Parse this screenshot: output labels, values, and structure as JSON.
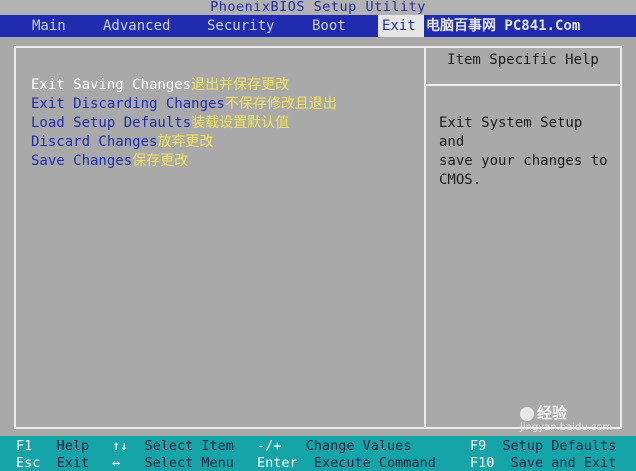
{
  "title": "PhoenixBIOS Setup Utility",
  "menu": [
    {
      "label": "Main"
    },
    {
      "label": "Advanced"
    },
    {
      "label": "Security"
    },
    {
      "label": "Boot"
    },
    {
      "label": "Exit",
      "active": true
    }
  ],
  "watermark": "电脑百事网 PC841.Com",
  "options": [
    {
      "en": "Exit Saving Changes",
      "cn": "退出并保存更改"
    },
    {
      "en": "Exit Discarding Changes",
      "cn": "不保存修改且退出"
    },
    {
      "en": "Load Setup Defaults",
      "cn": "装载设置默认值"
    },
    {
      "en": "Discard Changes",
      "cn": "放弃更改"
    },
    {
      "en": "Save Changes",
      "cn": "保存更改"
    }
  ],
  "help": {
    "title": "Item Specific Help",
    "text": "Exit System Setup and\nsave your changes to\nCMOS."
  },
  "footer": {
    "row1": [
      {
        "key": "F1",
        "desc": "Help"
      },
      {
        "key": "↑↓",
        "desc": "Select Item"
      },
      {
        "key": "-/+",
        "desc": "Change Values"
      },
      {
        "key": "F9",
        "desc": "Setup Defaults"
      }
    ],
    "row2": [
      {
        "key": "Esc",
        "desc": "Exit"
      },
      {
        "key": "↔",
        "desc": "Select Menu"
      },
      {
        "key": "Enter",
        "desc": "Execute Command"
      },
      {
        "key": "F10",
        "desc": "Save and Exit"
      }
    ]
  },
  "baidu": {
    "label": "经验",
    "url": "jingyan.baidu.com"
  },
  "colors": {
    "background": "#a9a9a9",
    "menubar": "#1f2cb0",
    "footer": "#15a4a8",
    "option_text": "#1f2cb0",
    "selected_text": "#ffffff",
    "annotation": "#f2e35a"
  }
}
